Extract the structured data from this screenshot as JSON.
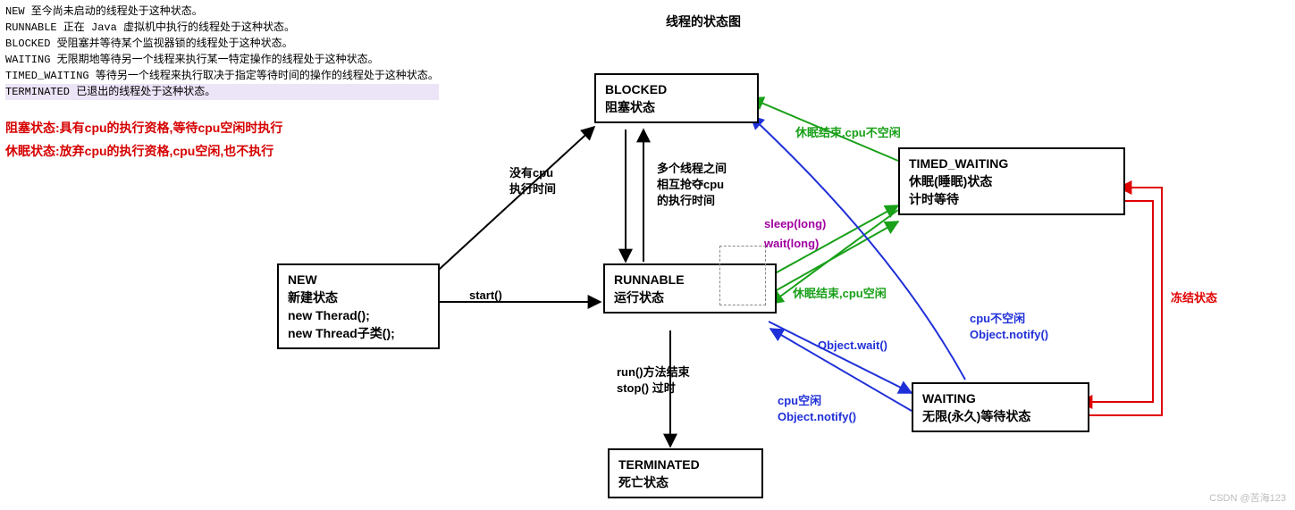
{
  "title": "线程的状态图",
  "legend": {
    "new": "NEW 至今尚未启动的线程处于这种状态。",
    "runnable": "RUNNABLE 正在 Java 虚拟机中执行的线程处于这种状态。",
    "blocked": "BLOCKED 受阻塞并等待某个监视器锁的线程处于这种状态。",
    "waiting": "WAITING 无限期地等待另一个线程来执行某一特定操作的线程处于这种状态。",
    "timed_waiting": "TIMED_WAITING 等待另一个线程来执行取决于指定等待时间的操作的线程处于这种状态。",
    "terminated": "TERMINATED 已退出的线程处于这种状态。"
  },
  "notes": {
    "blocked_def": "阻塞状态:具有cpu的执行资格,等待cpu空闲时执行",
    "sleep_def": "休眠状态:放弃cpu的执行资格,cpu空闲,也不执行"
  },
  "nodes": {
    "new": {
      "title": "NEW",
      "sub1": "新建状态",
      "sub2": "new Therad();",
      "sub3": "new Thread子类();"
    },
    "blocked": {
      "title": "BLOCKED",
      "sub1": "阻塞状态"
    },
    "runnable": {
      "title": "RUNNABLE",
      "sub1": "运行状态"
    },
    "timed_waiting": {
      "title": "TIMED_WAITING",
      "sub1": "休眠(睡眠)状态",
      "sub2": "计时等待"
    },
    "waiting": {
      "title": "WAITING",
      "sub1": "无限(永久)等待状态"
    },
    "terminated": {
      "title": "TERMINATED",
      "sub1": "死亡状态"
    }
  },
  "edges": {
    "start": "start()",
    "no_cpu": "没有cpu\n执行时间",
    "contend": "多个线程之间\n相互抢夺cpu\n的执行时间",
    "run_stop": "run()方法结束\nstop() 过时",
    "sleep_long": "sleep(long)",
    "wait_long": "wait(long)",
    "wake_busy1": "休眠结束,cpu不空闲",
    "wake_idle": "休眠结束,cpu空闲",
    "obj_wait": "Object.wait()",
    "cpu_idle_notify": "cpu空闲\nObject.notify()",
    "cpu_busy_notify": "cpu不空闲\nObject.notify()",
    "frozen": "冻结状态"
  },
  "watermark": "CSDN @苦海123"
}
